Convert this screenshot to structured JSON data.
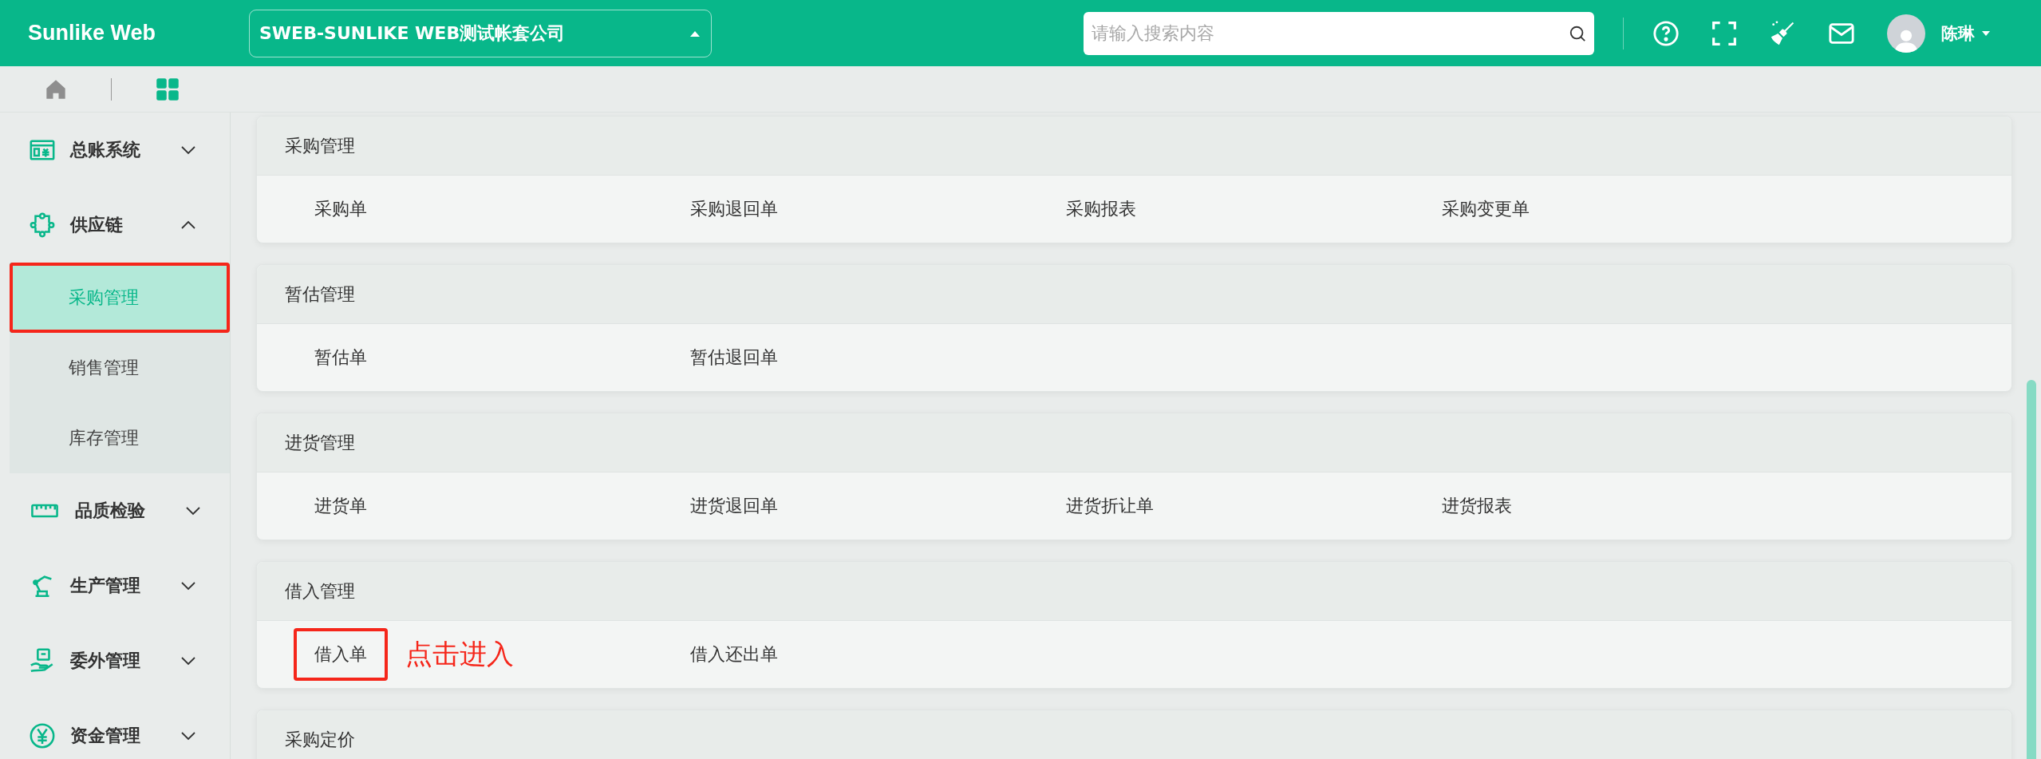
{
  "header": {
    "logo": "Sunlike Web",
    "company_select": {
      "value": "SWEB-SUNLIKE WEB测试帐套公司",
      "expanded": true
    },
    "search": {
      "placeholder": "请输入搜索内容"
    },
    "user": {
      "name": "陈琳"
    }
  },
  "sidebar": {
    "items": [
      {
        "label": "总账系统",
        "expanded": false
      },
      {
        "label": "供应链",
        "expanded": true,
        "children": [
          {
            "label": "采购管理",
            "selected": true,
            "highlighted": true
          },
          {
            "label": "销售管理",
            "selected": false,
            "highlighted": false
          },
          {
            "label": "库存管理",
            "selected": false,
            "highlighted": false
          }
        ]
      },
      {
        "label": "品质检验",
        "expanded": false
      },
      {
        "label": "生产管理",
        "expanded": false
      },
      {
        "label": "委外管理",
        "expanded": false
      },
      {
        "label": "资金管理",
        "expanded": false
      }
    ]
  },
  "sections": [
    {
      "title": "采购管理",
      "items": [
        {
          "label": "采购单",
          "highlighted": false
        },
        {
          "label": "采购退回单",
          "highlighted": false
        },
        {
          "label": "采购报表",
          "highlighted": false
        },
        {
          "label": "采购变更单",
          "highlighted": false
        }
      ]
    },
    {
      "title": "暂估管理",
      "items": [
        {
          "label": "暂估单",
          "highlighted": false
        },
        {
          "label": "暂估退回单",
          "highlighted": false
        }
      ]
    },
    {
      "title": "进货管理",
      "items": [
        {
          "label": "进货单",
          "highlighted": false
        },
        {
          "label": "进货退回单",
          "highlighted": false
        },
        {
          "label": "进货折让单",
          "highlighted": false
        },
        {
          "label": "进货报表",
          "highlighted": false
        }
      ]
    },
    {
      "title": "借入管理",
      "items": [
        {
          "label": "借入单",
          "highlighted": true,
          "annotation": "点击进入"
        },
        {
          "label": "借入还出单",
          "highlighted": false
        }
      ]
    },
    {
      "title": "采购定价"
    }
  ]
}
